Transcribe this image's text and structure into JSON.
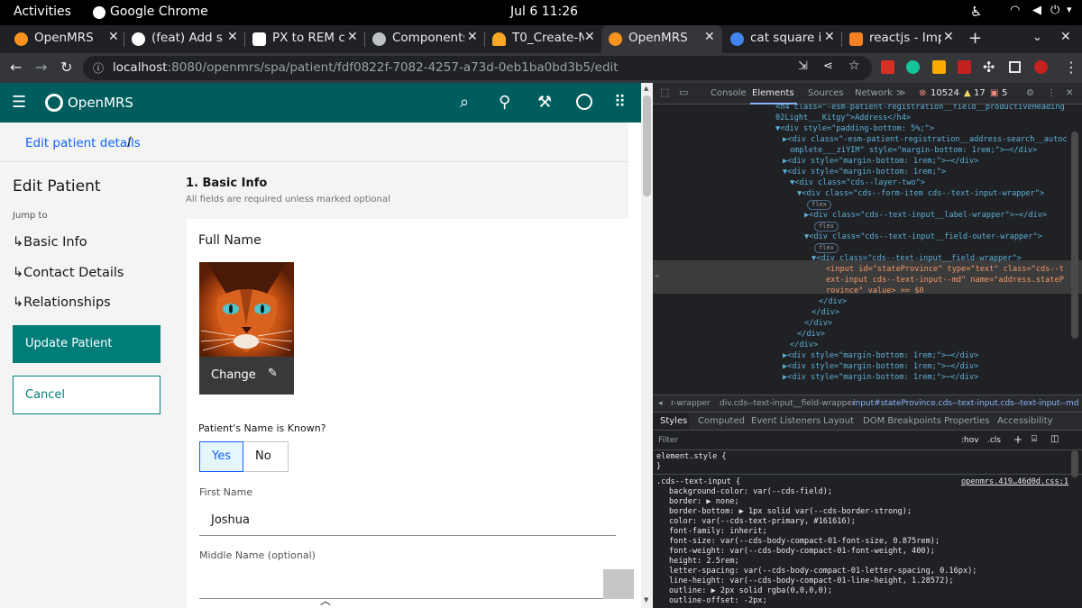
{
  "gnome": {
    "activities": "Activities",
    "app_name": "Google Chrome",
    "clock": "Jul 6  11:26"
  },
  "tabs": [
    {
      "label": "OpenMRS",
      "icon_color": "#f7931e"
    },
    {
      "label": "(feat) Add su",
      "icon_color": "#ffffff"
    },
    {
      "label": "PX to REM cc",
      "icon_color": "#ffffff"
    },
    {
      "label": "Components",
      "icon_color": "#bdc1c6"
    },
    {
      "label": "T0_Create-N",
      "icon_color": "#f9a825"
    },
    {
      "label": "OpenMRS",
      "icon_color": "#f7931e"
    },
    {
      "label": "cat square im",
      "icon_color": "#4285f4"
    },
    {
      "label": "reactjs - Imp",
      "icon_color": "#f48024"
    }
  ],
  "toolbar": {
    "url_host": "localhost",
    "url_path": ":8080/openmrs/spa/patient/fdf0822f-7082-4257-a73d-0eb1ba0bd3b5/edit"
  },
  "openmrs": {
    "brand": "OpenMRS",
    "breadcrumb_link": "Edit patient details",
    "breadcrumb_sep": "/",
    "page_title": "Edit Patient",
    "jump_to": "Jump to",
    "nav": [
      "Basic Info",
      "Contact Details",
      "Relationships"
    ],
    "update_button": "Update Patient",
    "cancel_button": "Cancel",
    "section_title": "1. Basic Info",
    "section_hint": "All fields are required unless marked optional",
    "full_name_title": "Full Name",
    "change_button": "Change",
    "name_known_label": "Patient's Name is Known?",
    "yes_label": "Yes",
    "no_label": "No",
    "first_name_label": "First Name",
    "first_name_value": "Joshua",
    "middle_name_label": "Middle Name (optional)",
    "middle_name_value": ""
  },
  "devtools": {
    "tabs": [
      "Console",
      "Elements",
      "Sources",
      "Network"
    ],
    "errors": "10524",
    "warnings": "17",
    "issues": "5",
    "breadcrumb": [
      "r-wrapper",
      "div.cds--text-input__field-wrapper",
      "input#stateProvince.cds--text-input.cds--text-input--md"
    ],
    "style_tabs": [
      "Styles",
      "Computed",
      "Event Listeners",
      "Layout",
      "DOM Breakpoints",
      "Properties",
      "Accessibility"
    ],
    "filter_placeholder": "Filter",
    "hov": ":hov",
    "cls": ".cls",
    "element_style": "element.style {",
    "brace_close": "}",
    "rule_selector": ".cds--text-input {",
    "rule_source": "openmrs.419…46d0d.css:1",
    "props": [
      "background-color: var(--cds-field);",
      "border: ▶ none;",
      "border-bottom: ▶ 1px solid var(--cds-border-strong);",
      "color: var(--cds-text-primary, #161616);",
      "font-family: inherit;",
      "font-size: var(--cds-body-compact-01-font-size, 0.875rem);",
      "font-weight: var(--cds-body-compact-01-font-weight, 400);",
      "height: 2.5rem;",
      "letter-spacing: var(--cds-body-compact-01-letter-spacing, 0.16px);",
      "line-height: var(--cds-body-compact-01-line-height, 1.28572);",
      "outline: ▶ 2px solid rgba(0,0,0,0);",
      "outline-offset: -2px;"
    ],
    "dom_lines": [
      "<h4 class=\"-esm-patient-registration__field__productiveHeading",
      "02Light___Kitgy\">Address</h4>",
      "▼<div style=\"padding-bottom: 5%;\">",
      "▶<div class=\"-esm-patient-registration__address-search__autoc",
      "omplete___ziYIM\" style=\"margin-bottom: 1rem;\">⋯</div>",
      "▶<div style=\"margin-bottom: 1rem;\">⋯</div>",
      "▼<div style=\"margin-bottom: 1rem;\">",
      "▼<div class=\"cds--layer-two\">",
      "▼<div class=\"cds--form-item cds--text-input-wrapper\">",
      "flex",
      "▶<div class=\"cds--text-input__label-wrapper\">⋯</div>",
      "flex",
      "▼<div class=\"cds--text-input__field-outer-wrapper\">",
      "flex",
      "▼<div class=\"cds--text-input__field-wrapper\">",
      "<input id=\"stateProvince\" type=\"text\" class=\"cds--t",
      "ext-input cds--text-input--md\" name=\"address.stateP",
      "rovince\" value> == $0",
      "</div>",
      "</div>",
      "</div>",
      "</div>",
      "</div>",
      "▶<div style=\"margin-bottom: 1rem;\">⋯</div>",
      "▶<div style=\"margin-bottom: 1rem;\">⋯</div>",
      "▶<div style=\"margin-bottom: 1rem;\">⋯</div>"
    ]
  },
  "colors": {
    "header": "#005d5d",
    "primary": "#007d79",
    "link": "#0f62fe",
    "selected_bg": "#e5f6ff"
  }
}
